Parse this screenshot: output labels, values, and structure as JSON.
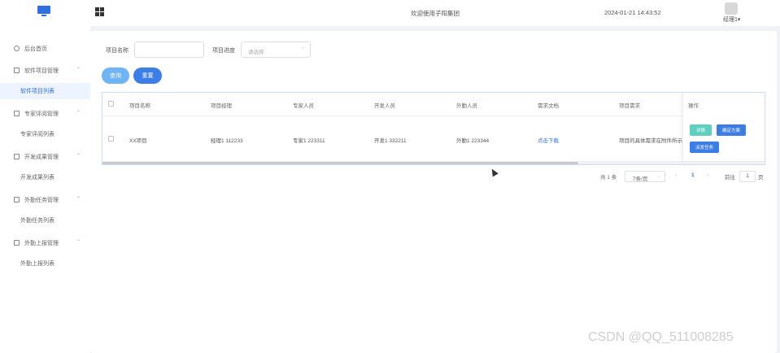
{
  "header": {
    "welcome": "欢迎使用子阳集团",
    "datetime": "2024-01-21 14:43:52",
    "user": "经理1▾",
    "icons": {
      "logo": "monitor-logo",
      "menu": "grid-apps-icon",
      "avatar": "avatar"
    }
  },
  "sidebar": {
    "items": [
      {
        "label": "后台首页",
        "icon": "clock-icon",
        "chev": ""
      },
      {
        "label": "软件项目管理",
        "icon": "folder-icon",
        "chev": "⌃"
      },
      {
        "label": "软件项目列表",
        "sub": true,
        "active": true
      },
      {
        "label": "专家评阅管理",
        "icon": "folder-icon",
        "chev": "⌃"
      },
      {
        "label": "专家评阅列表",
        "sub": true
      },
      {
        "label": "开发成果管理",
        "icon": "folder-icon",
        "chev": "⌃"
      },
      {
        "label": "开发成果列表",
        "sub": true
      },
      {
        "label": "外勤任务管理",
        "icon": "folder-icon",
        "chev": "⌃"
      },
      {
        "label": "外勤任务列表",
        "sub": true
      },
      {
        "label": "外勤上报管理",
        "icon": "folder-icon",
        "chev": "⌃"
      },
      {
        "label": "外勤上报列表",
        "sub": true
      }
    ]
  },
  "filters": {
    "name_label": "项目名称",
    "name_value": "",
    "progress_label": "项目进度",
    "progress_placeholder": "请选择",
    "query_button": "查询",
    "reset_button": "重置"
  },
  "table": {
    "columns": [
      "项目名称",
      "项目经理",
      "专家人员",
      "开发人员",
      "外勤人员",
      "需求文档",
      "项目需求",
      "操作"
    ],
    "rows": [
      {
        "name": "XX项目",
        "manager": "经理1 112233",
        "expert": "专家1 223311",
        "developer": "开发1 332211",
        "field": "外勤1 223344",
        "doc": "点击下载",
        "requirement": "项目的具体需求在附件所示",
        "actions": {
          "detail": "详情",
          "review": "确定方案",
          "assign": "派发任务"
        }
      }
    ]
  },
  "pagination": {
    "total": "共 1 条",
    "page_size": "7条/页",
    "prev": "‹",
    "page": "1",
    "next": "›",
    "goto_label": "前往",
    "goto_value": "1",
    "page_suffix": "页"
  },
  "watermark": "CSDN @QQ_511008285",
  "colors": {
    "primary": "#2f6fe0",
    "query": "#6fb4f5",
    "reset": "#3d7ee6",
    "detail": "#5fd0c0",
    "blue_btn": "#3d7ee6"
  }
}
